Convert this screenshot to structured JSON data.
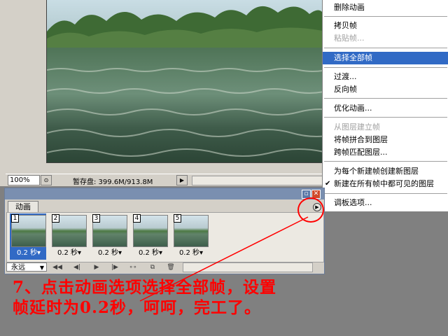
{
  "status_bar": {
    "zoom": "100%",
    "scratch": "暂存盘: 399.6M/913.8M"
  },
  "context_menu": {
    "items": [
      {
        "label": "删除动画",
        "disabled": false
      },
      {
        "label": "拷贝帧",
        "disabled": false
      },
      {
        "label": "粘贴帧...",
        "disabled": true
      },
      {
        "label": "选择全部帧",
        "disabled": false,
        "selected": true
      },
      {
        "label": "过渡...",
        "disabled": false
      },
      {
        "label": "反向帧",
        "disabled": false
      },
      {
        "label": "优化动画...",
        "disabled": false
      },
      {
        "label": "从图层建立帧",
        "disabled": true
      },
      {
        "label": "将帧拼合到图层",
        "disabled": false
      },
      {
        "label": "跨帧匹配图层...",
        "disabled": false
      },
      {
        "label": "为每个新建帧创建新图层",
        "disabled": false
      },
      {
        "label": "新建在所有帧中都可见的图层",
        "disabled": false,
        "checked": true
      },
      {
        "label": "调板选项...",
        "disabled": false
      }
    ]
  },
  "animation_panel": {
    "tab_label": "动画",
    "frames": [
      {
        "number": "1",
        "delay": "0.2 秒▾",
        "selected": true
      },
      {
        "number": "2",
        "delay": "0.2 秒▾",
        "selected": false
      },
      {
        "number": "3",
        "delay": "0.2 秒▾",
        "selected": false
      },
      {
        "number": "4",
        "delay": "0.2 秒▾",
        "selected": false
      },
      {
        "number": "5",
        "delay": "0.2 秒▾",
        "selected": false
      }
    ],
    "loop_option": "永远"
  },
  "annotation": {
    "line1": "7、点击动画选项选择全部帧，设置",
    "line2": "帧延时为0.2秒，呵呵，完工了。",
    "color": "#ff0000"
  }
}
